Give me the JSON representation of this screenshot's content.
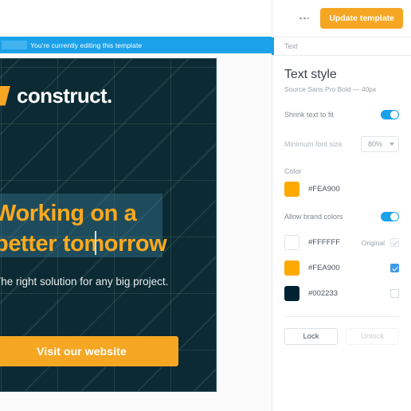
{
  "banner": {
    "text": "You're currently editing this template"
  },
  "artboard": {
    "logo_text": "construct.",
    "headline": "Working on a better tomorrow",
    "subtitle": "The right solution for any big project.",
    "cta_label": "Visit our website",
    "background_color": "#0B2A33",
    "headline_color": "#FCA91E",
    "cta_color": "#F5A623"
  },
  "panel": {
    "header": {
      "more_label": "...",
      "update_label": "Update template",
      "update_color": "#F5A623"
    },
    "breadcrumb": {
      "label": "Text",
      "accent_color": "#1BA1E8"
    },
    "title": "Text style",
    "subtitle": "Source Sans Pro Bold — 40px",
    "shrink": {
      "label": "Shrink text to fit",
      "state": "on"
    },
    "min_font_size": {
      "label": "Minimum font size",
      "value": "80%"
    },
    "color": {
      "label": "Color",
      "value": "#FEA900"
    },
    "brand_colors": {
      "label": "Allow brand colors",
      "state": "on",
      "original_label": "Original",
      "swatches": [
        {
          "hex": "#FFFFFF",
          "label": "#FFFFFF",
          "checked": "disabled-checked",
          "has_original": true
        },
        {
          "hex": "#FEA900",
          "label": "#FEA900",
          "checked": "checked",
          "has_original": false
        },
        {
          "hex": "#002233",
          "label": "#002233",
          "checked": "unchecked",
          "has_original": false
        }
      ]
    },
    "lock": {
      "lock_label": "Lock",
      "unlock_label": "Unlock"
    }
  }
}
